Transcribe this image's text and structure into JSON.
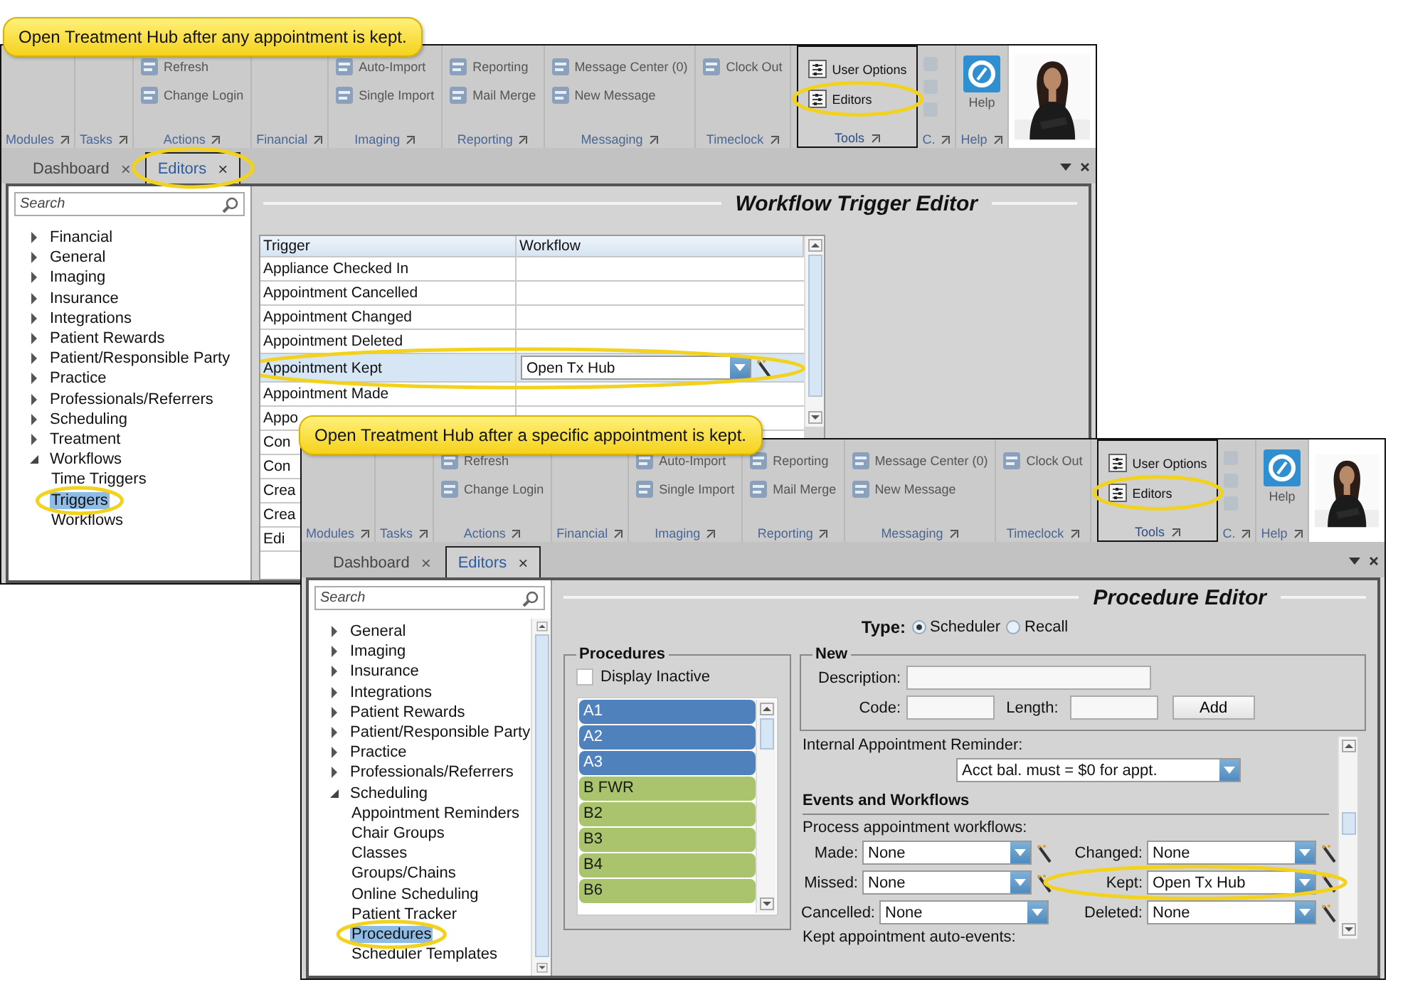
{
  "windows": [
    {
      "callout": "Open Treatment Hub after any appointment is kept.",
      "ribbon": {
        "groups": [
          {
            "label": "Modules",
            "dimmed": true,
            "boxed": false
          },
          {
            "label": "Tasks",
            "dimmed": true,
            "boxed": false
          },
          {
            "label": "Actions",
            "dimmed": true,
            "boxed": false,
            "items": [
              {
                "kind": "small",
                "label": "Refresh",
                "highlighted": false
              },
              {
                "kind": "small",
                "label": "Change Login",
                "highlighted": false
              }
            ]
          },
          {
            "label": "Financial",
            "dimmed": true,
            "boxed": false
          },
          {
            "label": "Imaging",
            "dimmed": true,
            "boxed": false,
            "items": [
              {
                "kind": "small",
                "label": "Auto-Import",
                "highlighted": false
              },
              {
                "kind": "small",
                "label": "Single Import",
                "highlighted": false
              }
            ]
          },
          {
            "label": "Reporting",
            "dimmed": true,
            "boxed": false,
            "items": [
              {
                "kind": "small",
                "label": "Reporting",
                "highlighted": false
              },
              {
                "kind": "small",
                "label": "Mail Merge",
                "highlighted": false
              }
            ]
          },
          {
            "label": "Messaging",
            "dimmed": true,
            "boxed": false,
            "items": [
              {
                "kind": "small",
                "label": "Message Center (0)",
                "highlighted": false
              },
              {
                "kind": "small",
                "label": "New Message",
                "highlighted": false
              }
            ]
          },
          {
            "label": "Timeclock",
            "dimmed": true,
            "boxed": false,
            "items": [
              {
                "kind": "small",
                "label": "Clock Out",
                "highlighted": false
              }
            ]
          },
          {
            "label": "Tools",
            "dimmed": false,
            "boxed": true,
            "items": [
              {
                "kind": "small",
                "label": "User Options",
                "highlighted": false
              },
              {
                "kind": "small",
                "label": "Editors",
                "highlighted": true
              }
            ]
          },
          {
            "label": "C.",
            "dimmed": true,
            "boxed": false,
            "items": [
              {
                "kind": "icon"
              },
              {
                "kind": "icon"
              },
              {
                "kind": "icon"
              }
            ]
          },
          {
            "label": "Help",
            "dimmed": true,
            "boxed": false,
            "items": [
              {
                "kind": "large",
                "label": "Help",
                "highlighted": false
              }
            ]
          }
        ]
      },
      "tabs": [
        {
          "label": "Dashboard",
          "close": "×",
          "selected": false,
          "highlighted": false
        },
        {
          "label": "Editors",
          "close": "×",
          "selected": true,
          "highlighted": true
        }
      ],
      "sidebar": {
        "placeholder": "Search",
        "scrollbar": false,
        "tree": [
          {
            "label": "Financial",
            "expanded": false,
            "selected": false,
            "highlighted": false
          },
          {
            "label": "General",
            "expanded": false,
            "selected": false,
            "highlighted": false
          },
          {
            "label": "Imaging",
            "expanded": false,
            "selected": false,
            "highlighted": false
          },
          {
            "label": "Insurance",
            "expanded": false,
            "selected": false,
            "highlighted": false
          },
          {
            "label": "Integrations",
            "expanded": false,
            "selected": false,
            "highlighted": false
          },
          {
            "label": "Patient Rewards",
            "expanded": false,
            "selected": false,
            "highlighted": false
          },
          {
            "label": "Patient/Responsible Party",
            "expanded": false,
            "selected": false,
            "highlighted": false
          },
          {
            "label": "Practice",
            "expanded": false,
            "selected": false,
            "highlighted": false
          },
          {
            "label": "Professionals/Referrers",
            "expanded": false,
            "selected": false,
            "highlighted": false
          },
          {
            "label": "Scheduling",
            "expanded": false,
            "selected": false,
            "highlighted": false
          },
          {
            "label": "Treatment",
            "expanded": false,
            "selected": false,
            "highlighted": false
          },
          {
            "label": "Workflows",
            "expanded": true,
            "selected": false,
            "highlighted": false,
            "children": [
              {
                "label": "Time Triggers",
                "selected": false,
                "highlighted": false
              },
              {
                "label": "Triggers",
                "selected": true,
                "highlighted": true
              },
              {
                "label": "Workflows",
                "selected": false,
                "highlighted": false
              }
            ]
          }
        ]
      },
      "editor": {
        "kind": "trigger_table",
        "title": "Workflow Trigger Editor",
        "columns": [
          "Trigger",
          "Workflow"
        ],
        "rows": [
          {
            "trigger": "Appliance Checked In",
            "selected": false,
            "highlighted": false
          },
          {
            "trigger": "Appointment Cancelled",
            "selected": false,
            "highlighted": false
          },
          {
            "trigger": "Appointment Changed",
            "selected": false,
            "highlighted": false
          },
          {
            "trigger": "Appointment Deleted",
            "selected": false,
            "highlighted": false
          },
          {
            "trigger": "Appointment Kept",
            "workflow": "Open Tx Hub",
            "selected": true,
            "highlighted": true
          },
          {
            "trigger": "Appointment Made",
            "selected": false,
            "highlighted": false
          },
          {
            "trigger": "Appo",
            "selected": false,
            "highlighted": false
          },
          {
            "trigger": "Con",
            "selected": false,
            "highlighted": false
          },
          {
            "trigger": "Con",
            "selected": false,
            "highlighted": false
          },
          {
            "trigger": "Crea",
            "selected": false,
            "highlighted": false
          },
          {
            "trigger": "Crea",
            "selected": false,
            "highlighted": false
          },
          {
            "trigger": "Edi",
            "selected": false,
            "highlighted": false
          }
        ]
      }
    },
    {
      "callout": "Open Treatment Hub after a specific appointment is kept.",
      "ribbon": {
        "groups": [
          {
            "label": "Modules",
            "dimmed": true,
            "boxed": false
          },
          {
            "label": "Tasks",
            "dimmed": true,
            "boxed": false
          },
          {
            "label": "Actions",
            "dimmed": true,
            "boxed": false,
            "items": [
              {
                "kind": "small",
                "label": "Refresh",
                "highlighted": false
              },
              {
                "kind": "small",
                "label": "Change Login",
                "highlighted": false
              }
            ]
          },
          {
            "label": "Financial",
            "dimmed": true,
            "boxed": false
          },
          {
            "label": "Imaging",
            "dimmed": true,
            "boxed": false,
            "items": [
              {
                "kind": "small",
                "label": "Auto-Import",
                "highlighted": false
              },
              {
                "kind": "small",
                "label": "Single Import",
                "highlighted": false
              }
            ]
          },
          {
            "label": "Reporting",
            "dimmed": true,
            "boxed": false,
            "items": [
              {
                "kind": "small",
                "label": "Reporting",
                "highlighted": false
              },
              {
                "kind": "small",
                "label": "Mail Merge",
                "highlighted": false
              }
            ]
          },
          {
            "label": "Messaging",
            "dimmed": true,
            "boxed": false,
            "items": [
              {
                "kind": "small",
                "label": "Message Center (0)",
                "highlighted": false
              },
              {
                "kind": "small",
                "label": "New Message",
                "highlighted": false
              }
            ]
          },
          {
            "label": "Timeclock",
            "dimmed": true,
            "boxed": false,
            "items": [
              {
                "kind": "small",
                "label": "Clock Out",
                "highlighted": false
              }
            ]
          },
          {
            "label": "Tools",
            "dimmed": false,
            "boxed": true,
            "items": [
              {
                "kind": "small",
                "label": "User Options",
                "highlighted": false
              },
              {
                "kind": "small",
                "label": "Editors",
                "highlighted": true
              }
            ]
          },
          {
            "label": "C.",
            "dimmed": true,
            "boxed": false,
            "items": [
              {
                "kind": "icon"
              },
              {
                "kind": "icon"
              },
              {
                "kind": "icon"
              }
            ]
          },
          {
            "label": "Help",
            "dimmed": true,
            "boxed": false,
            "items": [
              {
                "kind": "large",
                "label": "Help",
                "highlighted": false
              }
            ]
          }
        ]
      },
      "tabs": [
        {
          "label": "Dashboard",
          "close": "×",
          "selected": false,
          "highlighted": false
        },
        {
          "label": "Editors",
          "close": "×",
          "selected": true,
          "highlighted": false
        }
      ],
      "sidebar": {
        "placeholder": "Search",
        "scrollbar": true,
        "tree": [
          {
            "label": "General",
            "expanded": false,
            "selected": false,
            "highlighted": false
          },
          {
            "label": "Imaging",
            "expanded": false,
            "selected": false,
            "highlighted": false
          },
          {
            "label": "Insurance",
            "expanded": false,
            "selected": false,
            "highlighted": false
          },
          {
            "label": "Integrations",
            "expanded": false,
            "selected": false,
            "highlighted": false
          },
          {
            "label": "Patient Rewards",
            "expanded": false,
            "selected": false,
            "highlighted": false
          },
          {
            "label": "Patient/Responsible Party",
            "expanded": false,
            "selected": false,
            "highlighted": false
          },
          {
            "label": "Practice",
            "expanded": false,
            "selected": false,
            "highlighted": false
          },
          {
            "label": "Professionals/Referrers",
            "expanded": false,
            "selected": false,
            "highlighted": false
          },
          {
            "label": "Scheduling",
            "expanded": true,
            "selected": false,
            "highlighted": false,
            "children": [
              {
                "label": "Appointment Reminders",
                "selected": false,
                "highlighted": false
              },
              {
                "label": "Chair Groups",
                "selected": false,
                "highlighted": false
              },
              {
                "label": "Classes",
                "selected": false,
                "highlighted": false
              },
              {
                "label": "Groups/Chains",
                "selected": false,
                "highlighted": false
              },
              {
                "label": "Online Scheduling",
                "selected": false,
                "highlighted": false
              },
              {
                "label": "Patient Tracker",
                "selected": false,
                "highlighted": false
              },
              {
                "label": "Procedures",
                "selected": true,
                "highlighted": true
              },
              {
                "label": "Scheduler Templates",
                "selected": false,
                "highlighted": false
              }
            ]
          }
        ]
      },
      "editor": {
        "kind": "procedure_editor",
        "title": "Procedure Editor",
        "type": {
          "label": "Type:",
          "options": [
            {
              "label": "Scheduler",
              "selected": true
            },
            {
              "label": "Recall",
              "selected": false
            }
          ]
        },
        "procedures": {
          "title": "Procedures",
          "display_inactive": {
            "label": "Display Inactive",
            "checked": false
          },
          "items": [
            {
              "label": "A1",
              "color": "#4f81bd"
            },
            {
              "label": "A2",
              "color": "#4f81bd"
            },
            {
              "label": "A3",
              "color": "#4f81bd"
            },
            {
              "label": "B FWR",
              "color": "#a9c46c"
            },
            {
              "label": "B2",
              "color": "#a9c46c"
            },
            {
              "label": "B3",
              "color": "#a9c46c"
            },
            {
              "label": "B4",
              "color": "#a9c46c"
            },
            {
              "label": "B6",
              "color": "#a9c46c"
            }
          ]
        },
        "new": {
          "title": "New",
          "description_label": "Description:",
          "code_label": "Code:",
          "length_label": "Length:",
          "button": "Add"
        },
        "reminder": {
          "label": "Internal Appointment Reminder:",
          "value": "Acct bal. must = $0 for appt."
        },
        "events": {
          "title": "Events and Workflows",
          "subtitle": "Process appointment workflows:",
          "workflows": [
            {
              "label": "Made:",
              "value": "None",
              "highlighted": false
            },
            {
              "label": "Changed:",
              "value": "None",
              "highlighted": false
            },
            {
              "label": "Missed:",
              "value": "None",
              "highlighted": false
            },
            {
              "label": "Kept:",
              "value": "Open Tx Hub",
              "highlighted": true
            },
            {
              "label": "Cancelled:",
              "value": "None",
              "highlighted": false
            },
            {
              "label": "Deleted:",
              "value": "None",
              "highlighted": false
            }
          ],
          "footer": "Kept appointment auto-events:"
        }
      }
    }
  ]
}
